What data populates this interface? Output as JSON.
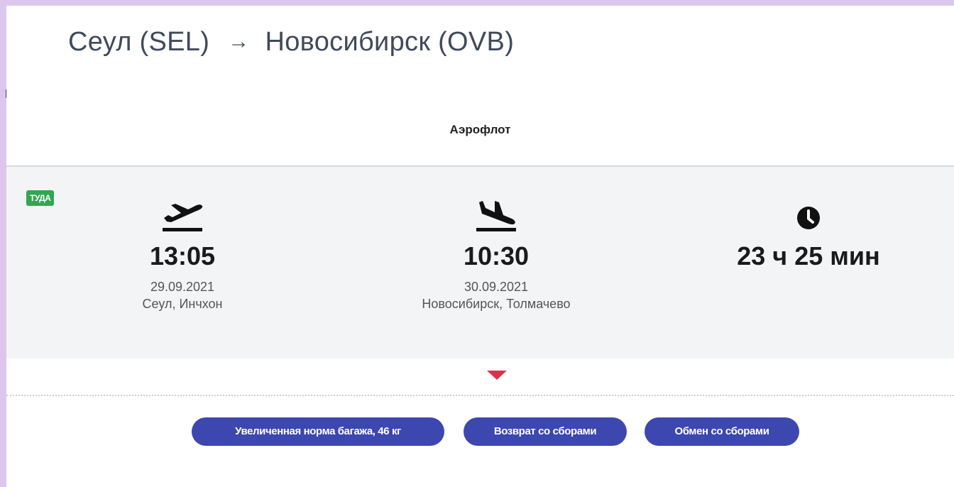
{
  "header": {
    "origin": "Сеул (SEL)",
    "arrow": "→",
    "destination": "Новосибирск (OVB)"
  },
  "airline": {
    "name": "Аэрофлот"
  },
  "segment": {
    "direction_badge": "ТУДА",
    "departure": {
      "icon": "takeoff-icon",
      "time": "13:05",
      "date": "29.09.2021",
      "place": "Сеул, Инчхон"
    },
    "arrival": {
      "icon": "landing-icon",
      "time": "10:30",
      "date": "30.09.2021",
      "place": "Новосибирск, Толмачево"
    },
    "duration": {
      "icon": "clock-icon",
      "value": "23 ч 25 мин"
    }
  },
  "details_toggle_icon": "caret-down-icon",
  "tags": [
    {
      "label": "Увеличенная норма багажа, 46 кг"
    },
    {
      "label": "Возврат со сборами"
    },
    {
      "label": "Обмен со сборами"
    }
  ],
  "colors": {
    "badge": "#2fa84f",
    "tag": "#3d47b0",
    "toggle": "#d6334a",
    "frame": "#dcc6ee"
  }
}
